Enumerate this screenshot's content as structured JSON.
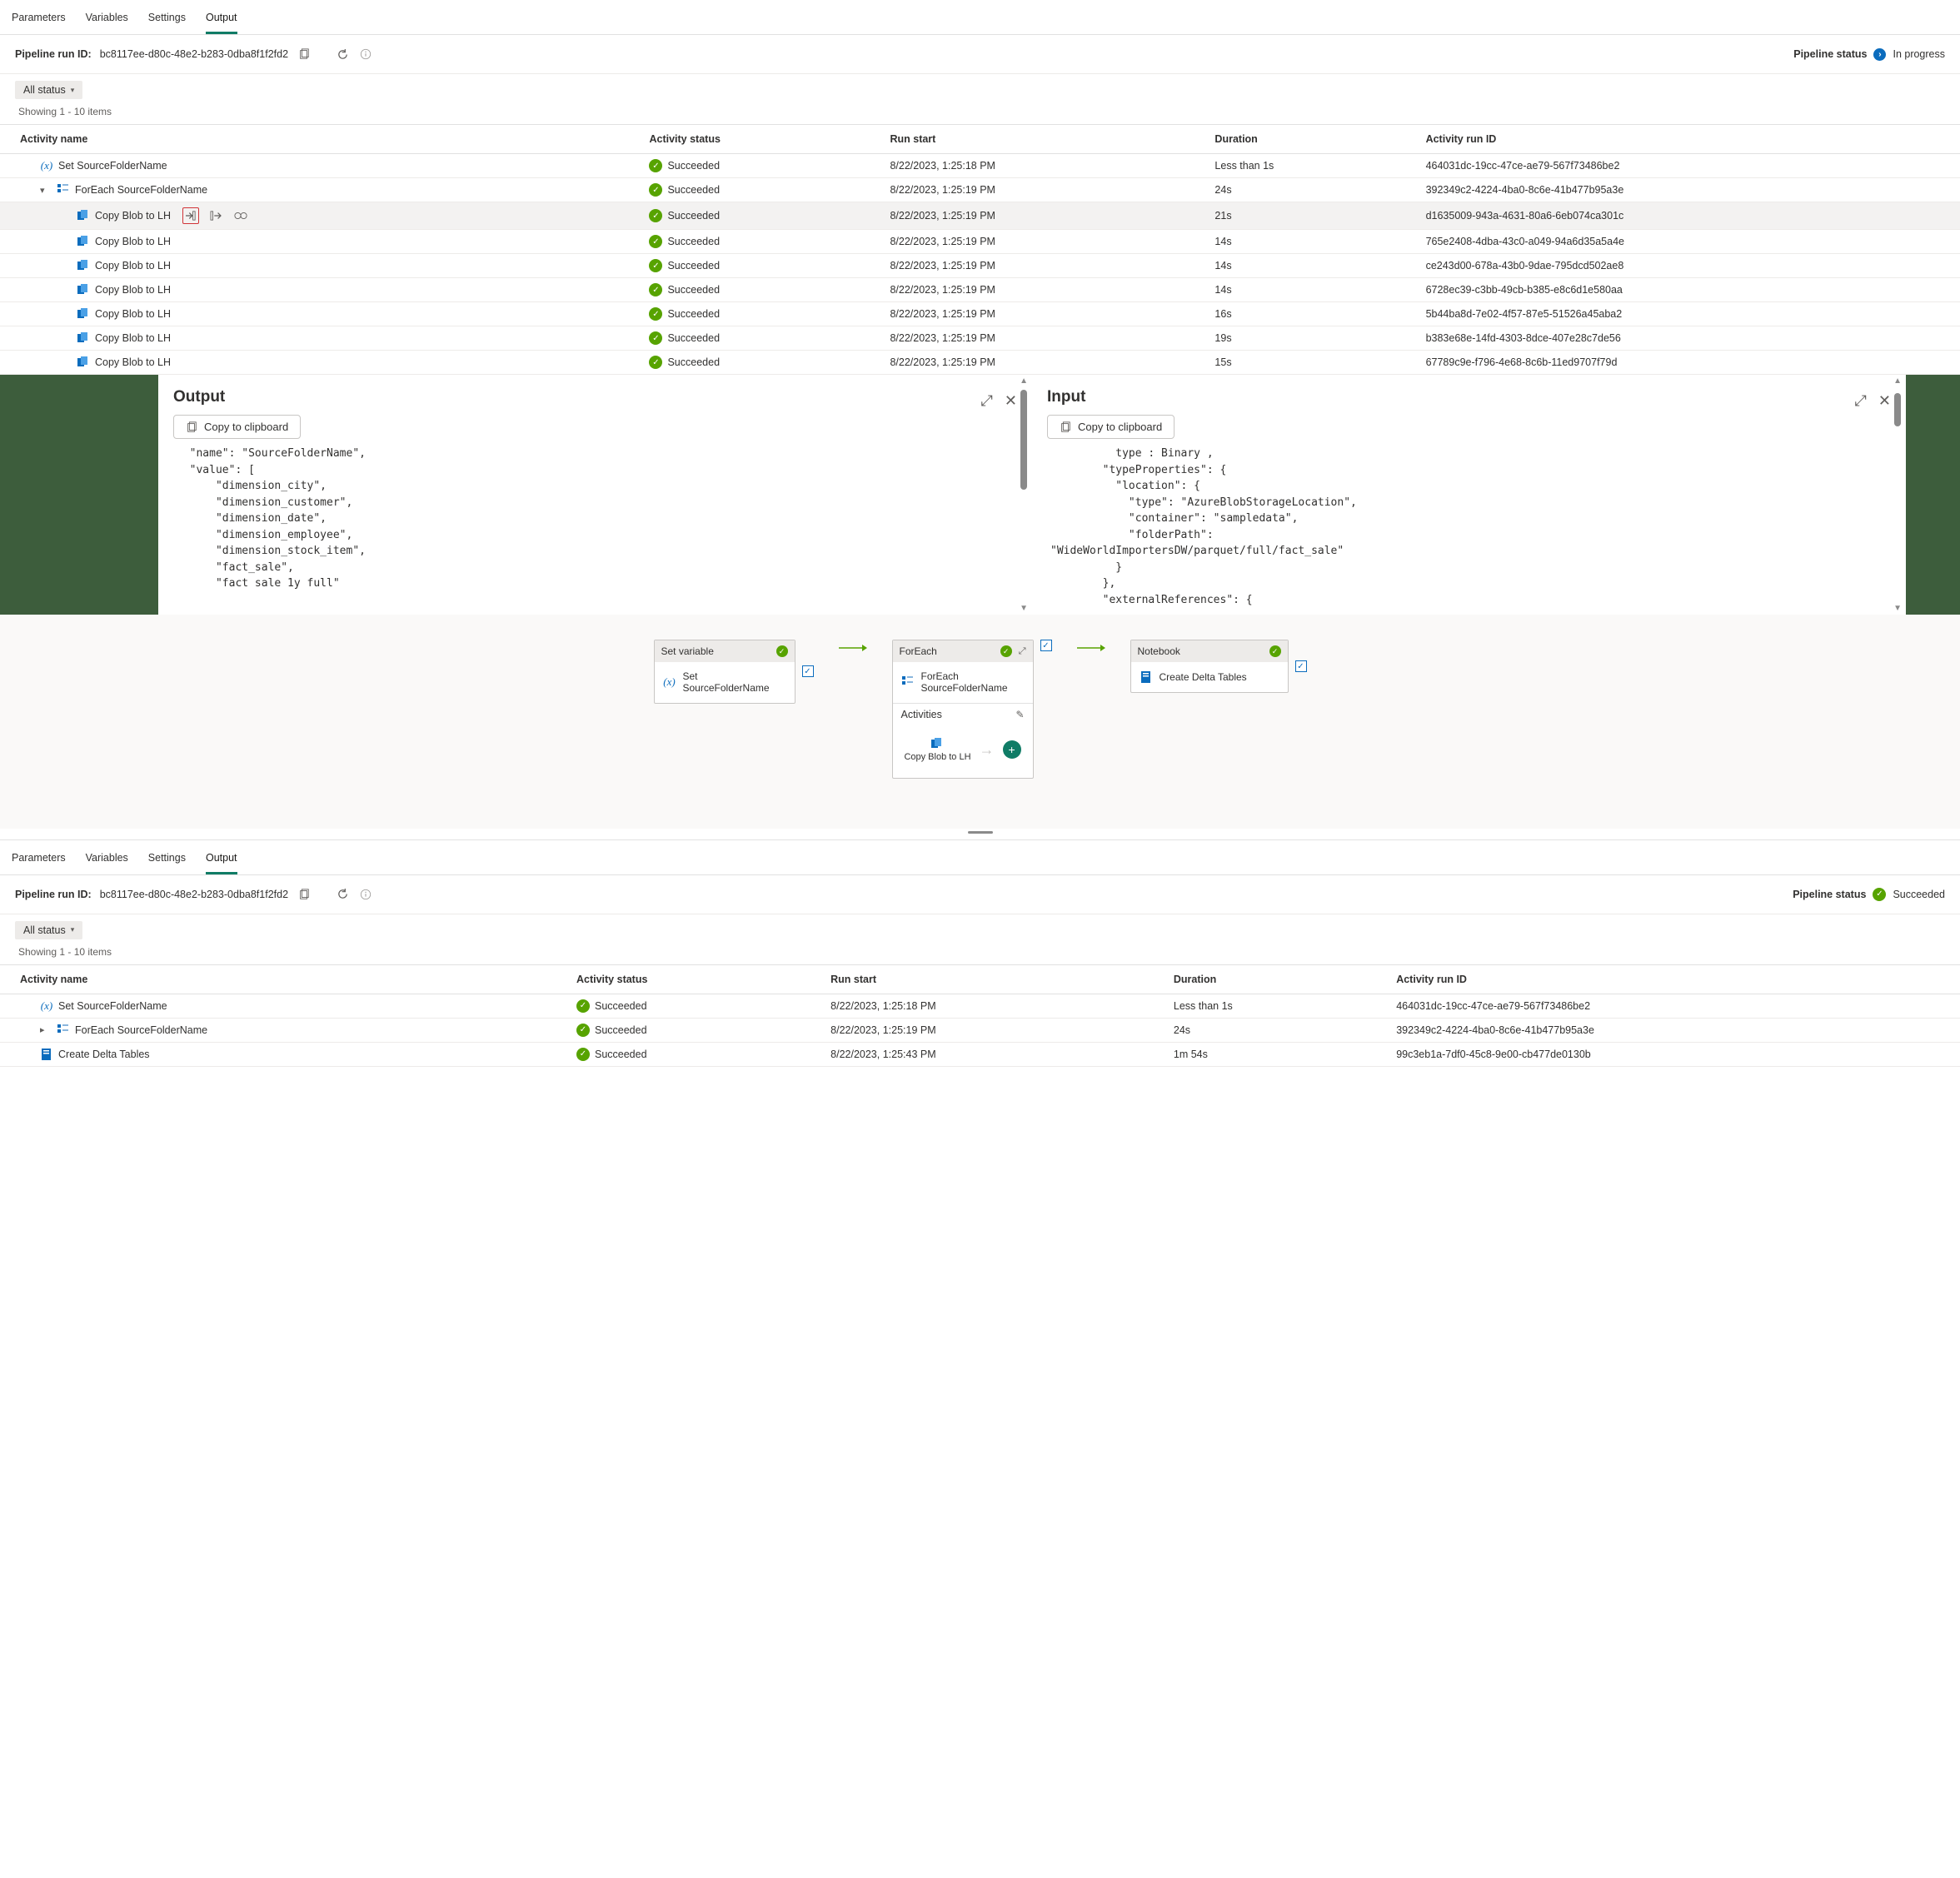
{
  "tabs": [
    "Parameters",
    "Variables",
    "Settings",
    "Output"
  ],
  "active_tab": "Output",
  "run_id_label": "Pipeline run ID:",
  "run_id_value": "bc8117ee-d80c-48e2-b283-0dba8f1f2fd2",
  "status_label": "Pipeline status",
  "status_value_top": "In progress",
  "status_value_bottom": "Succeeded",
  "filter_chip": "All status",
  "showing_text": "Showing 1 - 10 items",
  "showing_text_bottom": "Showing 1 - 10 items",
  "headers": {
    "name": "Activity name",
    "status": "Activity status",
    "start": "Run start",
    "duration": "Duration",
    "runid": "Activity run ID"
  },
  "rows_top": [
    {
      "icon": "var",
      "name": "Set SourceFolderName",
      "indent": 1,
      "chev": "",
      "status": "Succeeded",
      "start": "8/22/2023, 1:25:18 PM",
      "duration": "Less than 1s",
      "id": "464031dc-19cc-47ce-ae79-567f73486be2"
    },
    {
      "icon": "seq",
      "name": "ForEach SourceFolderName",
      "indent": 2,
      "chev": "open",
      "status": "Succeeded",
      "start": "8/22/2023, 1:25:19 PM",
      "duration": "24s",
      "id": "392349c2-4224-4ba0-8c6e-41b477b95a3e"
    },
    {
      "icon": "copy",
      "name": "Copy Blob to LH",
      "indent": 3,
      "highlight": true,
      "actions": true,
      "status": "Succeeded",
      "start": "8/22/2023, 1:25:19 PM",
      "duration": "21s",
      "id": "d1635009-943a-4631-80a6-6eb074ca301c"
    },
    {
      "icon": "copy",
      "name": "Copy Blob to LH",
      "indent": 3,
      "status": "Succeeded",
      "start": "8/22/2023, 1:25:19 PM",
      "duration": "14s",
      "id": "765e2408-4dba-43c0-a049-94a6d35a5a4e"
    },
    {
      "icon": "copy",
      "name": "Copy Blob to LH",
      "indent": 3,
      "status": "Succeeded",
      "start": "8/22/2023, 1:25:19 PM",
      "duration": "14s",
      "id": "ce243d00-678a-43b0-9dae-795dcd502ae8"
    },
    {
      "icon": "copy",
      "name": "Copy Blob to LH",
      "indent": 3,
      "status": "Succeeded",
      "start": "8/22/2023, 1:25:19 PM",
      "duration": "14s",
      "id": "6728ec39-c3bb-49cb-b385-e8c6d1e580aa"
    },
    {
      "icon": "copy",
      "name": "Copy Blob to LH",
      "indent": 3,
      "status": "Succeeded",
      "start": "8/22/2023, 1:25:19 PM",
      "duration": "16s",
      "id": "5b44ba8d-7e02-4f57-87e5-51526a45aba2"
    },
    {
      "icon": "copy",
      "name": "Copy Blob to LH",
      "indent": 3,
      "status": "Succeeded",
      "start": "8/22/2023, 1:25:19 PM",
      "duration": "19s",
      "id": "b383e68e-14fd-4303-8dce-407e28c7de56"
    },
    {
      "icon": "copy",
      "name": "Copy Blob to LH",
      "indent": 3,
      "status": "Succeeded",
      "start": "8/22/2023, 1:25:19 PM",
      "duration": "15s",
      "id": "67789c9e-f796-4e68-8c6b-11ed9707f79d"
    }
  ],
  "rows_bottom": [
    {
      "icon": "var",
      "name": "Set SourceFolderName",
      "indent": 1,
      "chev": "",
      "status": "Succeeded",
      "start": "8/22/2023, 1:25:18 PM",
      "duration": "Less than 1s",
      "id": "464031dc-19cc-47ce-ae79-567f73486be2"
    },
    {
      "icon": "seq",
      "name": "ForEach SourceFolderName",
      "indent": 2,
      "chev": "closed",
      "status": "Succeeded",
      "start": "8/22/2023, 1:25:19 PM",
      "duration": "24s",
      "id": "392349c2-4224-4ba0-8c6e-41b477b95a3e"
    },
    {
      "icon": "nb",
      "name": "Create Delta Tables",
      "indent": 1,
      "chev": "",
      "status": "Succeeded",
      "start": "8/22/2023, 1:25:43 PM",
      "duration": "1m 54s",
      "id": "99c3eb1a-7df0-45c8-9e00-cb477de0130b"
    }
  ],
  "output_panel": {
    "title": "Output",
    "copy_label": "Copy to clipboard",
    "code": "  \"name\": \"SourceFolderName\",\n  \"value\": [\n      \"dimension_city\",\n      \"dimension_customer\",\n      \"dimension_date\",\n      \"dimension_employee\",\n      \"dimension_stock_item\",\n      \"fact_sale\",\n      \"fact sale 1y full\""
  },
  "input_panel": {
    "title": "Input",
    "copy_label": "Copy to clipboard",
    "code": "          type : Binary ,\n        \"typeProperties\": {\n          \"location\": {\n            \"type\": \"AzureBlobStorageLocation\",\n            \"container\": \"sampledata\",\n            \"folderPath\":\n\"WideWorldImportersDW/parquet/full/fact_sale\"\n          }\n        },\n        \"externalReferences\": {"
  },
  "canvas": {
    "setvar": {
      "head": "Set variable",
      "line1": "Set",
      "line2": "SourceFolderName"
    },
    "foreach": {
      "head": "ForEach",
      "line1": "ForEach",
      "line2": "SourceFolderName",
      "activities": "Activities",
      "act1": "Copy Blob to LH"
    },
    "notebook": {
      "head": "Notebook",
      "line1": "Create Delta Tables"
    }
  }
}
